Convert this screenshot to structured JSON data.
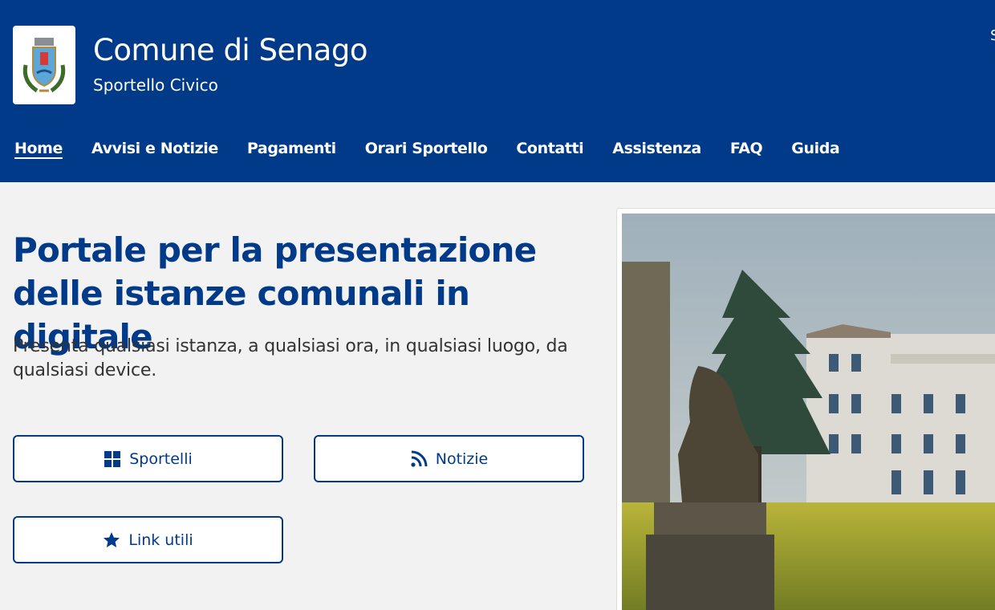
{
  "header": {
    "title": "Comune di Senago",
    "subtitle": "Sportello Civico",
    "corner_text": "S"
  },
  "nav": {
    "items": [
      {
        "label": "Home",
        "active": true
      },
      {
        "label": "Avvisi e Notizie"
      },
      {
        "label": "Pagamenti"
      },
      {
        "label": "Orari Sportello"
      },
      {
        "label": "Contatti"
      },
      {
        "label": "Assistenza"
      },
      {
        "label": "FAQ"
      },
      {
        "label": "Guida"
      }
    ]
  },
  "hero": {
    "title": "Portale per la presentazione delle istanze comunali in digitale",
    "lead": "Presenta qualsiasi istanza, a qualsiasi ora, in qualsiasi luogo, da qualsiasi device."
  },
  "buttons": {
    "sportelli": {
      "label": "Sportelli",
      "icon": "grid-icon"
    },
    "notizie": {
      "label": "Notizie",
      "icon": "rss-icon"
    },
    "link_utili": {
      "label": "Link utili",
      "icon": "star-icon"
    }
  },
  "colors": {
    "brand_blue": "#003a88",
    "page_bg": "#f2f2f2"
  }
}
